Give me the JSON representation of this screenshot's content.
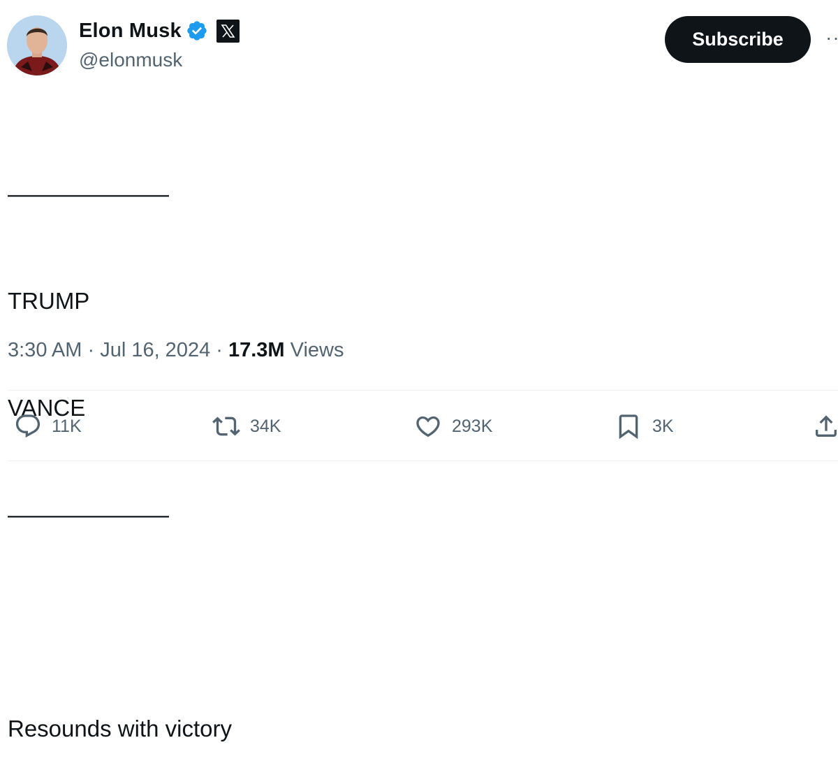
{
  "author": {
    "display_name": "Elon Musk",
    "handle": "@elonmusk",
    "verified": true,
    "affiliation_badge": "x-logo-icon"
  },
  "header": {
    "subscribe_label": "Subscribe",
    "more_label": "··"
  },
  "tweet": {
    "lines": [
      "———————",
      "TRUMP",
      "VANCE",
      "———————",
      "",
      "Resounds with victory"
    ]
  },
  "meta": {
    "time": "3:30 AM",
    "separator": " · ",
    "date": "Jul 16, 2024",
    "views_count": "17.3M",
    "views_label": " Views"
  },
  "actions": {
    "replies": "11K",
    "reposts": "34K",
    "likes": "293K",
    "bookmarks": "3K"
  },
  "colors": {
    "verified_blue": "#1d9bf0",
    "text_primary": "#0f1419",
    "text_secondary": "#536471",
    "button_bg": "#0f1419"
  }
}
